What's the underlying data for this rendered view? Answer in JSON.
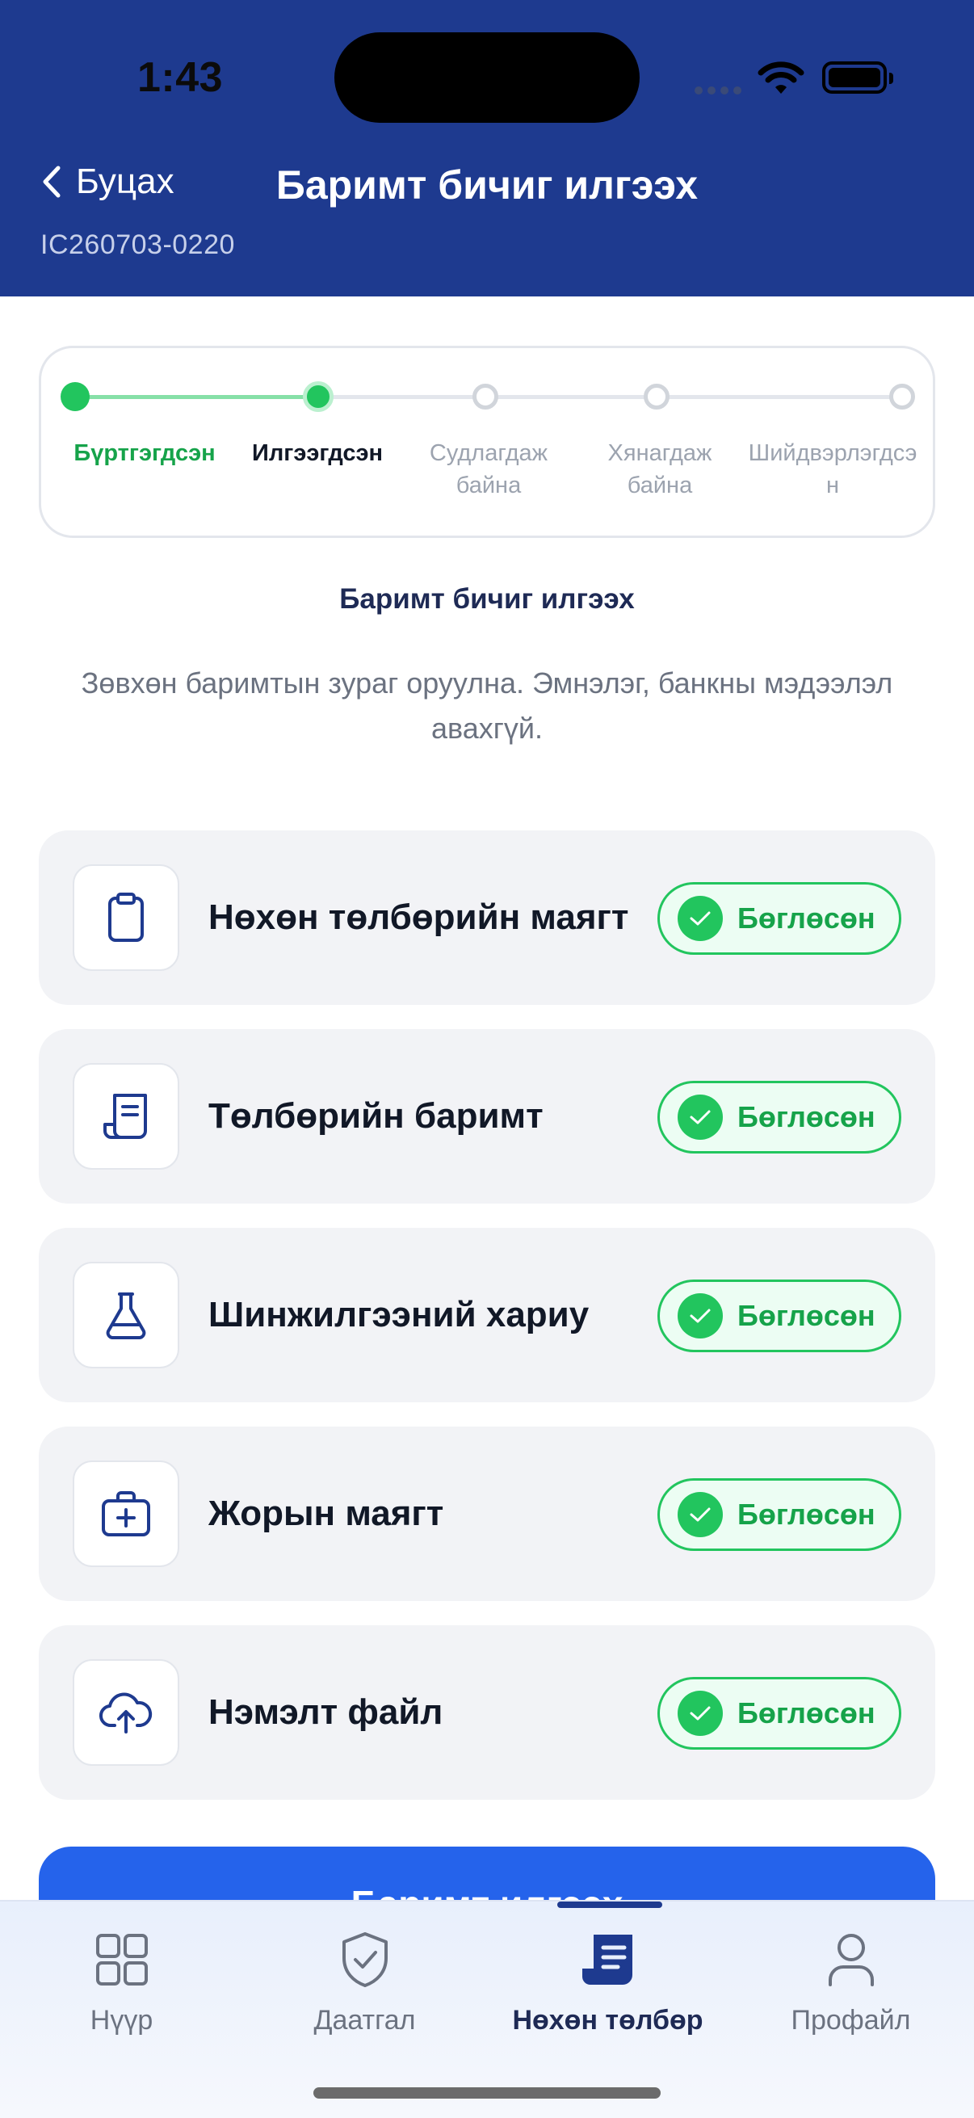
{
  "status_bar": {
    "time": "1:43"
  },
  "header": {
    "back_label": "Буцах",
    "title": "Баримт бичиг илгээх",
    "claim_id": "IC260703-0220",
    "color": "#1e3a8f"
  },
  "stepper": {
    "steps": [
      {
        "label": "Бүртгэгдсэн",
        "state": "done"
      },
      {
        "label": "Илгээгдсэн",
        "state": "current"
      },
      {
        "label": "Судлагдаж байна",
        "state": "pending"
      },
      {
        "label": "Хянагдаж байна",
        "state": "pending"
      },
      {
        "label": "Шийдвэрлэгдсэн",
        "state": "pending"
      }
    ],
    "done_color": "#22c55e",
    "pending_color": "#d1d5db"
  },
  "section": {
    "title": "Баримт бичиг илгээх",
    "description": "Зөвхөн баримтын зураг оруулна. Эмнэлэг, банкны мэдээлэл авахгүй."
  },
  "documents": [
    {
      "label": "Нөхөн төлбөрийн маягт",
      "icon": "clipboard-icon",
      "status": "Бөглөсөн"
    },
    {
      "label": "Төлбөрийн баримт",
      "icon": "receipt-icon",
      "status": "Бөглөсөн"
    },
    {
      "label": "Шинжилгээний хариу",
      "icon": "flask-icon",
      "status": "Бөглөсөн"
    },
    {
      "label": "Жорын маягт",
      "icon": "medical-kit-icon",
      "status": "Бөглөсөн"
    },
    {
      "label": "Нэмэлт файл",
      "icon": "cloud-upload-icon",
      "status": "Бөглөсөн"
    }
  ],
  "primary_button": {
    "label": "Баримт илгээх"
  },
  "tabbar": {
    "tabs": [
      {
        "label": "Нүүр",
        "icon": "grid-icon"
      },
      {
        "label": "Даатгал",
        "icon": "shield-check-icon"
      },
      {
        "label": "Нөхөн төлбөр",
        "icon": "claim-document-icon",
        "active": true
      },
      {
        "label": "Профайл",
        "icon": "user-icon"
      }
    ]
  }
}
